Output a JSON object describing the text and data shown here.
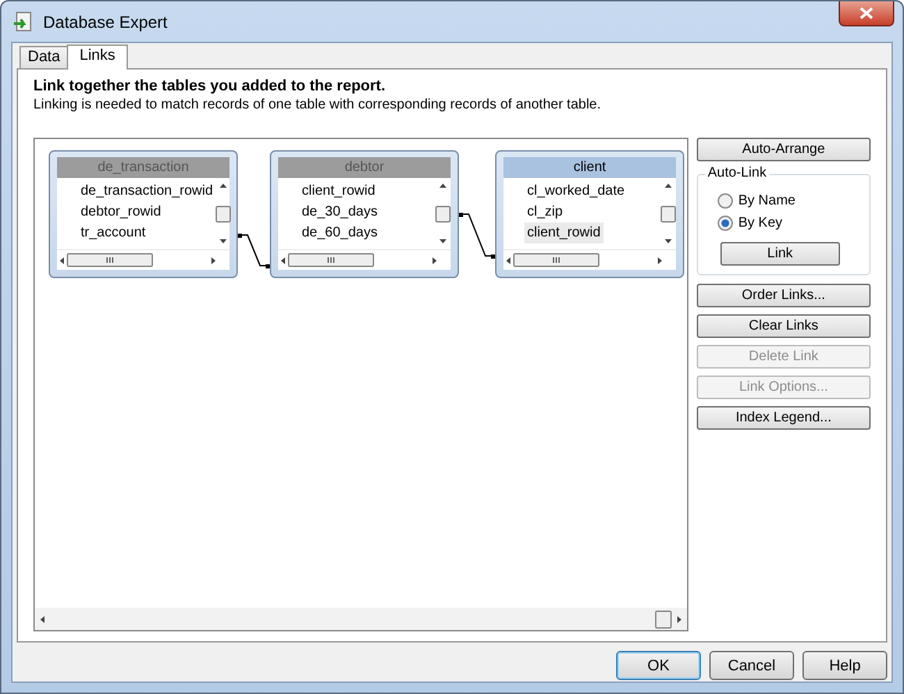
{
  "window": {
    "title": "Database Expert"
  },
  "tabs": [
    {
      "label": "Data",
      "selected": false
    },
    {
      "label": "Links",
      "selected": true
    }
  ],
  "heading": "Link together the tables you added to the report.",
  "description": "Linking is needed to match records of one table with corresponding records of another table.",
  "tables": [
    {
      "name": "de_transaction",
      "selected": false,
      "fields": [
        {
          "name": "de_transaction_rowid",
          "highlighted": false
        },
        {
          "name": "debtor_rowid",
          "highlighted": false
        },
        {
          "name": "tr_account",
          "highlighted": false
        }
      ]
    },
    {
      "name": "debtor",
      "selected": false,
      "fields": [
        {
          "name": "client_rowid",
          "highlighted": false
        },
        {
          "name": "de_30_days",
          "highlighted": false
        },
        {
          "name": "de_60_days",
          "highlighted": false
        }
      ]
    },
    {
      "name": "client",
      "selected": true,
      "fields": [
        {
          "name": "cl_worked_date",
          "highlighted": false
        },
        {
          "name": "cl_zip",
          "highlighted": false
        },
        {
          "name": "client_rowid",
          "highlighted": true
        }
      ]
    }
  ],
  "links": [
    {
      "kind": "link"
    },
    {
      "kind": "link"
    }
  ],
  "side_buttons_top": [
    {
      "label": "Auto-Arrange",
      "disabled": false
    }
  ],
  "auto_link": {
    "title": "Auto-Link",
    "options": [
      {
        "label": "By Name",
        "selected": false
      },
      {
        "label": "By Key",
        "selected": true
      }
    ],
    "button": {
      "label": "Link",
      "disabled": false
    }
  },
  "side_buttons": [
    {
      "label": "Order Links...",
      "disabled": false
    },
    {
      "label": "Clear Links",
      "disabled": false
    },
    {
      "label": "Delete Link",
      "disabled": true
    },
    {
      "label": "Link Options...",
      "disabled": true
    },
    {
      "label": "Index Legend...",
      "disabled": false
    }
  ],
  "footer_buttons": [
    {
      "label": "OK",
      "default": true
    },
    {
      "label": "Cancel",
      "default": false
    },
    {
      "label": "Help",
      "default": false
    }
  ]
}
